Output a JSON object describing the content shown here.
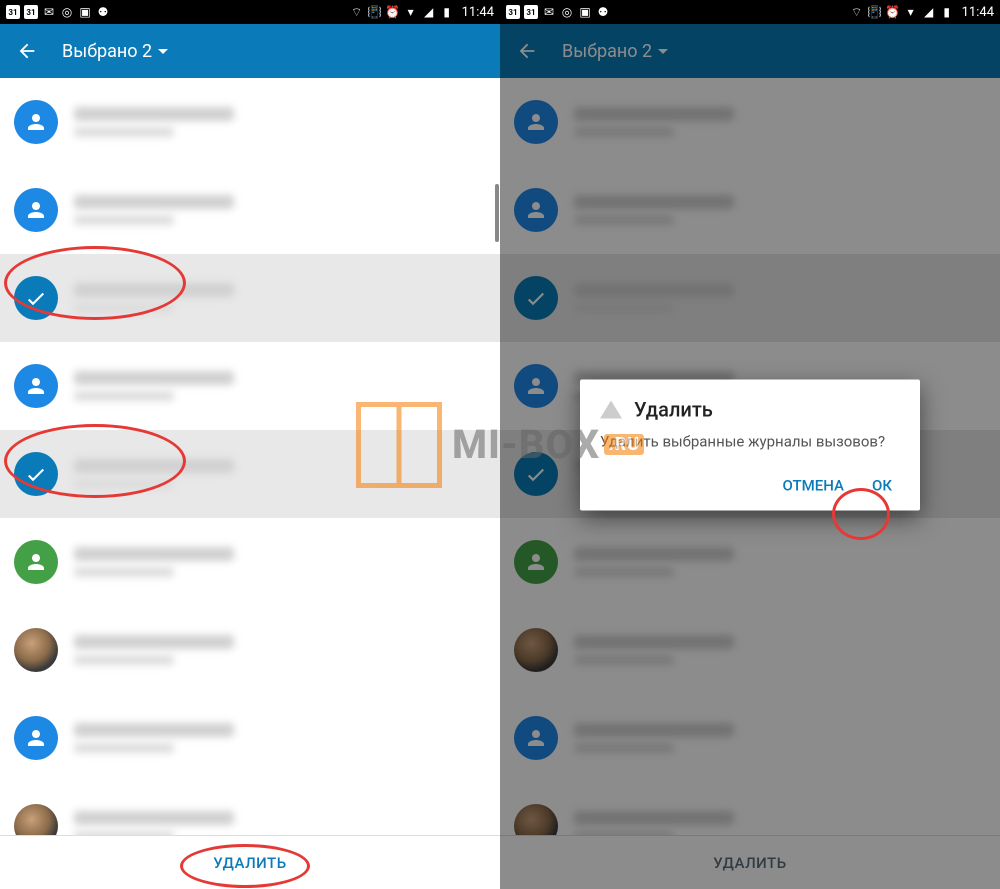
{
  "statusbar": {
    "time": "11:44",
    "cal": "31"
  },
  "appbar": {
    "title": "Выбрано 2"
  },
  "list": {
    "items": [
      {
        "type": "contact",
        "avatar": "blue",
        "selected": false
      },
      {
        "type": "contact",
        "avatar": "blue",
        "selected": false
      },
      {
        "type": "contact",
        "avatar": "check",
        "selected": true
      },
      {
        "type": "contact",
        "avatar": "blue",
        "selected": false
      },
      {
        "type": "contact",
        "avatar": "check",
        "selected": true
      },
      {
        "type": "contact",
        "avatar": "green",
        "selected": false
      },
      {
        "type": "contact",
        "avatar": "photo",
        "selected": false
      },
      {
        "type": "contact",
        "avatar": "blue",
        "selected": false
      },
      {
        "type": "contact",
        "avatar": "photo",
        "selected": false
      }
    ]
  },
  "bottom": {
    "delete": "УДАЛИТЬ"
  },
  "dialog": {
    "title": "Удалить",
    "body": "Удалить выбранные журналы вызовов?",
    "cancel": "ОТМЕНА",
    "ok": "ОК"
  },
  "watermark": {
    "text": "MI-BOX",
    "suffix": ".RU"
  },
  "colors": {
    "accent": "#0A7AB8",
    "highlight": "#E53935"
  }
}
